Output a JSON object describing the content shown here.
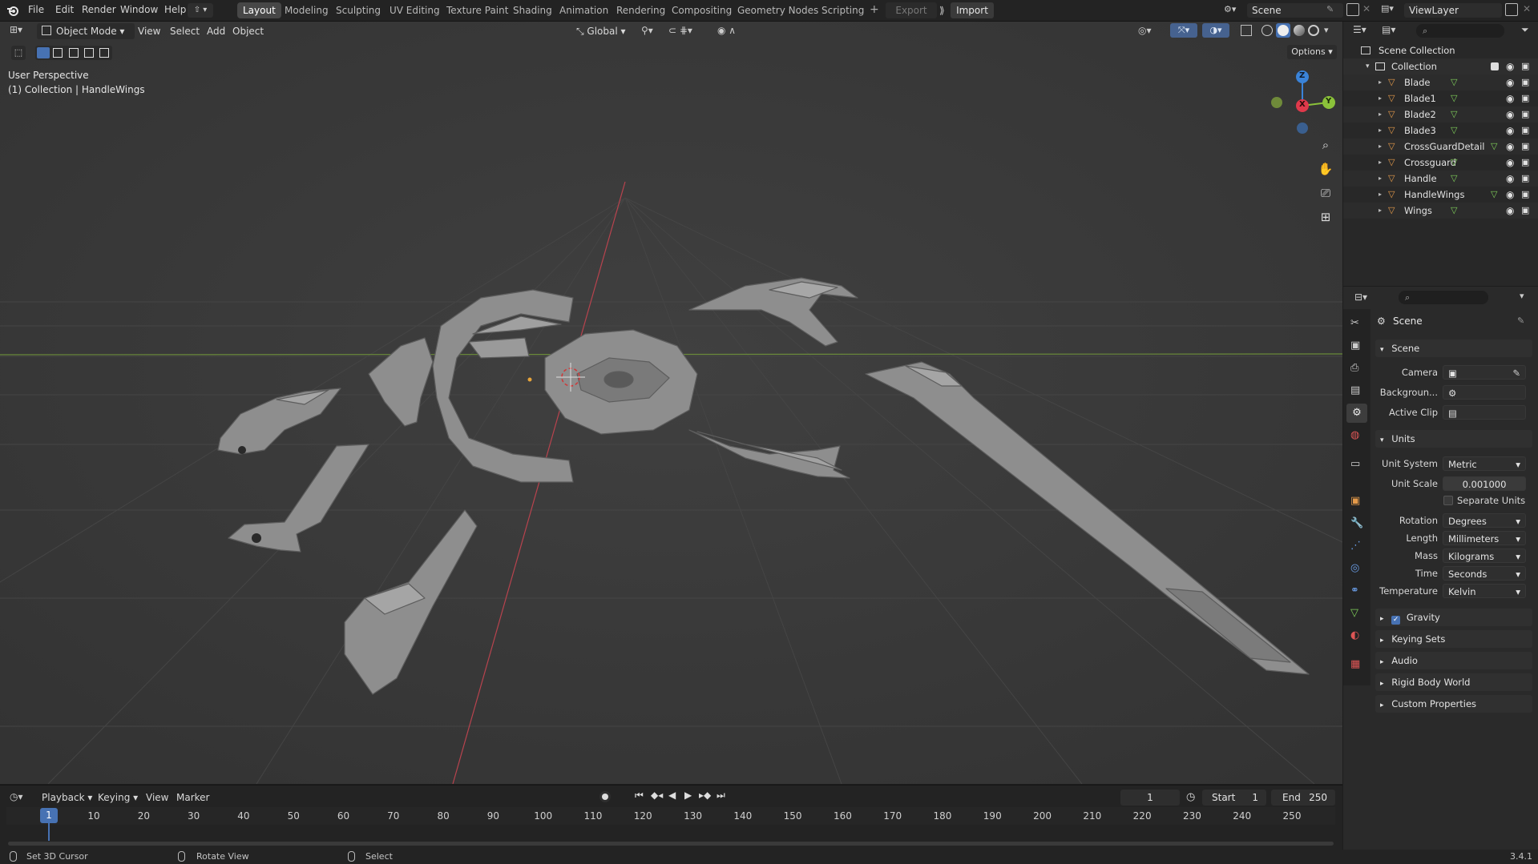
{
  "app": {
    "version": "3.4.1"
  },
  "topbar": {
    "menus": [
      "File",
      "Edit",
      "Render",
      "Window",
      "Help"
    ],
    "workspaces": [
      "Layout",
      "Modeling",
      "Sculpting",
      "UV Editing",
      "Texture Paint",
      "Shading",
      "Animation",
      "Rendering",
      "Compositing",
      "Geometry Nodes",
      "Scripting"
    ],
    "active_workspace": "Layout",
    "export_label": "Export",
    "import_label": "Import",
    "scene_name": "Scene",
    "view_layer": "ViewLayer"
  },
  "viewport": {
    "mode": "Object Mode",
    "menus": [
      "View",
      "Select",
      "Add",
      "Object"
    ],
    "transform_orientation": "Global",
    "options_label": "Options",
    "overlay_title": "User Perspective",
    "overlay_subtitle": "(1) Collection | HandleWings",
    "gizmo": {
      "x": "X",
      "y": "Y",
      "z": "Z"
    }
  },
  "outliner": {
    "root": "Scene Collection",
    "collection": "Collection",
    "objects": [
      "Blade",
      "Blade1",
      "Blade2",
      "Blade3",
      "CrossGuardDetails",
      "Crossguard",
      "Handle",
      "HandleWings",
      "Wings"
    ]
  },
  "properties": {
    "header": "Scene",
    "scene_panel": {
      "title": "Scene",
      "camera_label": "Camera",
      "background_label": "Backgroun...",
      "active_clip_label": "Active Clip"
    },
    "units_panel": {
      "title": "Units",
      "unit_system_label": "Unit System",
      "unit_system": "Metric",
      "unit_scale_label": "Unit Scale",
      "unit_scale": "0.001000",
      "separate_units": "Separate Units",
      "rotation_label": "Rotation",
      "rotation": "Degrees",
      "length_label": "Length",
      "length": "Millimeters",
      "mass_label": "Mass",
      "mass": "Kilograms",
      "time_label": "Time",
      "time": "Seconds",
      "temperature_label": "Temperature",
      "temperature": "Kelvin"
    },
    "collapsed_panels": [
      "Gravity",
      "Keying Sets",
      "Audio",
      "Rigid Body World",
      "Custom Properties"
    ]
  },
  "timeline": {
    "menus": [
      "Playback",
      "Keying",
      "View",
      "Marker"
    ],
    "current_frame": "1",
    "start_label": "Start",
    "start": "1",
    "end_label": "End",
    "end": "250",
    "ticks": [
      "1",
      "10",
      "20",
      "30",
      "40",
      "50",
      "60",
      "70",
      "80",
      "90",
      "100",
      "110",
      "120",
      "130",
      "140",
      "150",
      "160",
      "170",
      "180",
      "190",
      "200",
      "210",
      "220",
      "230",
      "240",
      "250"
    ]
  },
  "statusbar": {
    "hint1": "Set 3D Cursor",
    "hint2": "Rotate View",
    "hint3": "Select"
  },
  "colors": {
    "accent": "#4772b3",
    "axis_x": "#e0394b",
    "axis_y": "#8bc23a",
    "axis_z": "#3a83d8",
    "mesh": "#8e8e8e"
  }
}
